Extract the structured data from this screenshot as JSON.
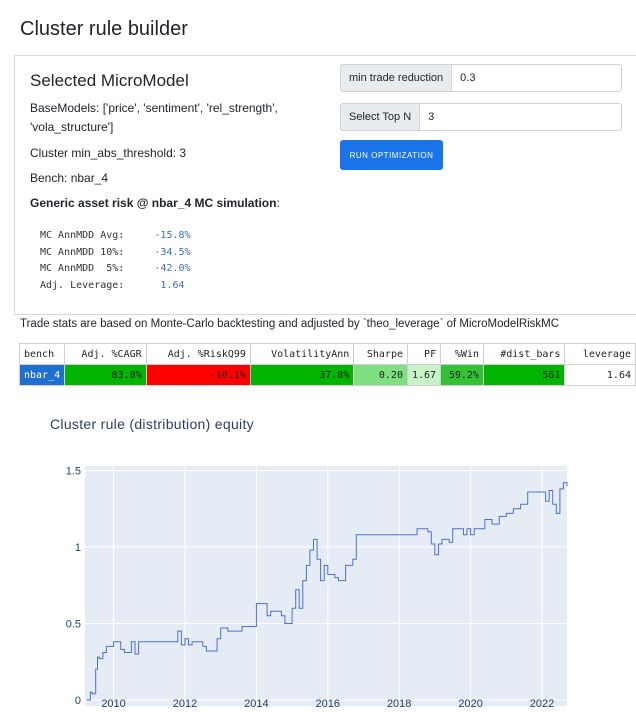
{
  "page_title": "Cluster rule builder",
  "micromodel": {
    "title": "Selected MicroModel",
    "base_models": "BaseModels: ['price', 'sentiment', 'rel_strength', 'vola_structure']",
    "threshold": "Cluster min_abs_threshold: 3",
    "bench": "Bench: nbar_4",
    "risk_heading": "Generic asset risk @ nbar_4 MC simulation",
    "risk_suffix": ":",
    "mc_rows": [
      {
        "label": "MC AnnMDD Avg:   ",
        "value": "  -15.8%"
      },
      {
        "label": "MC AnnMDD 10%:   ",
        "value": "  -34.5%"
      },
      {
        "label": "MC AnnMDD  5%:   ",
        "value": "  -42.0%"
      },
      {
        "label": "Adj. Leverage:   ",
        "value": "   1.64"
      }
    ]
  },
  "controls": {
    "min_trade_reduction_label": "min trade reduction",
    "min_trade_reduction_value": "0.3",
    "select_top_n_label": "Select Top N",
    "select_top_n_value": "3",
    "run_button": "RUN OPTIMIZATION"
  },
  "note": "Trade stats are based on Monte-Carlo backtesting and adjusted by `theo_leverage` of MicroModelRiskMC",
  "stats_table": {
    "headers": [
      "bench",
      "Adj. %CAGR",
      "Adj. %RiskQ99",
      "VolatilityAnn",
      "Sharpe",
      "PF",
      "%Win",
      "#dist_bars",
      "leverage"
    ],
    "row": [
      "nbar_4",
      "83.8%",
      "-10.1%",
      "37.8%",
      "0.20",
      "1.67",
      "59.2%",
      "561",
      "1.64"
    ],
    "cell_colors": [
      "#1f6fd1",
      "#00b400",
      "#ff0000",
      "#00b400",
      "#7fe07f",
      "#c8f3c8",
      "#33c233",
      "#00b400",
      "#ffffff"
    ],
    "cell_text_colors": [
      "#ffffff",
      "#222222",
      "#222222",
      "#222222",
      "#222222",
      "#222222",
      "#222222",
      "#222222",
      "#222222"
    ]
  },
  "chart_title": "Cluster rule (distribution) equity",
  "chart_data": {
    "type": "line",
    "title": "Cluster rule (distribution) equity",
    "xlabel": "",
    "ylabel": "",
    "x_ticks": [
      "2010",
      "2012",
      "2014",
      "2016",
      "2018",
      "2020",
      "2022"
    ],
    "y_ticks": [
      "0",
      "0.5",
      "1",
      "1.5"
    ],
    "xlim": [
      2009.2,
      2022.7
    ],
    "ylim": [
      -0.04,
      1.53
    ],
    "grid": true,
    "line_color": "#4c6fd6",
    "plot_bg": "#e5ecf6",
    "series": [
      {
        "x": [
          2009.25,
          2009.35,
          2009.4,
          2009.5,
          2009.55,
          2009.6,
          2009.7,
          2009.8,
          2010.0,
          2010.2,
          2010.3,
          2010.5,
          2010.6,
          2010.7,
          2010.8,
          2011.0,
          2011.2,
          2011.5,
          2011.8,
          2011.9,
          2012.0,
          2012.1,
          2012.2,
          2012.3,
          2012.5,
          2012.6,
          2012.9,
          2013.0,
          2013.2,
          2013.5,
          2013.6,
          2013.9,
          2014.0,
          2014.3,
          2014.4,
          2014.6,
          2014.7,
          2014.8,
          2015.0,
          2015.1,
          2015.2,
          2015.3,
          2015.4,
          2015.5,
          2015.6,
          2015.7,
          2015.8,
          2015.9,
          2016.0,
          2016.2,
          2016.3,
          2016.5,
          2016.7,
          2016.8,
          2017.0,
          2017.5,
          2018.0,
          2018.3,
          2018.5,
          2018.6,
          2018.8,
          2018.9,
          2019.0,
          2019.1,
          2019.2,
          2019.4,
          2019.5,
          2019.8,
          2019.9,
          2020.0,
          2020.1,
          2020.4,
          2020.6,
          2020.8,
          2021.0,
          2021.2,
          2021.4,
          2021.6,
          2021.8,
          2022.0,
          2022.1,
          2022.2,
          2022.3,
          2022.4,
          2022.5,
          2022.6,
          2022.7
        ],
        "y": [
          0.0,
          0.05,
          0.04,
          0.2,
          0.28,
          0.27,
          0.31,
          0.35,
          0.38,
          0.33,
          0.31,
          0.38,
          0.3,
          0.38,
          0.38,
          0.38,
          0.38,
          0.38,
          0.45,
          0.36,
          0.4,
          0.36,
          0.38,
          0.38,
          0.35,
          0.32,
          0.4,
          0.47,
          0.45,
          0.45,
          0.48,
          0.48,
          0.63,
          0.55,
          0.58,
          0.58,
          0.55,
          0.5,
          0.6,
          0.72,
          0.6,
          0.78,
          0.88,
          0.98,
          1.05,
          0.92,
          0.78,
          0.88,
          0.82,
          0.8,
          0.78,
          0.88,
          0.92,
          1.08,
          1.08,
          1.08,
          1.08,
          1.08,
          1.12,
          1.12,
          1.1,
          1.02,
          0.95,
          1.02,
          1.05,
          1.03,
          1.12,
          1.08,
          1.12,
          1.08,
          1.12,
          1.18,
          1.15,
          1.2,
          1.22,
          1.25,
          1.28,
          1.36,
          1.36,
          1.36,
          1.3,
          1.37,
          1.28,
          1.22,
          1.38,
          1.42,
          1.4
        ]
      }
    ]
  }
}
